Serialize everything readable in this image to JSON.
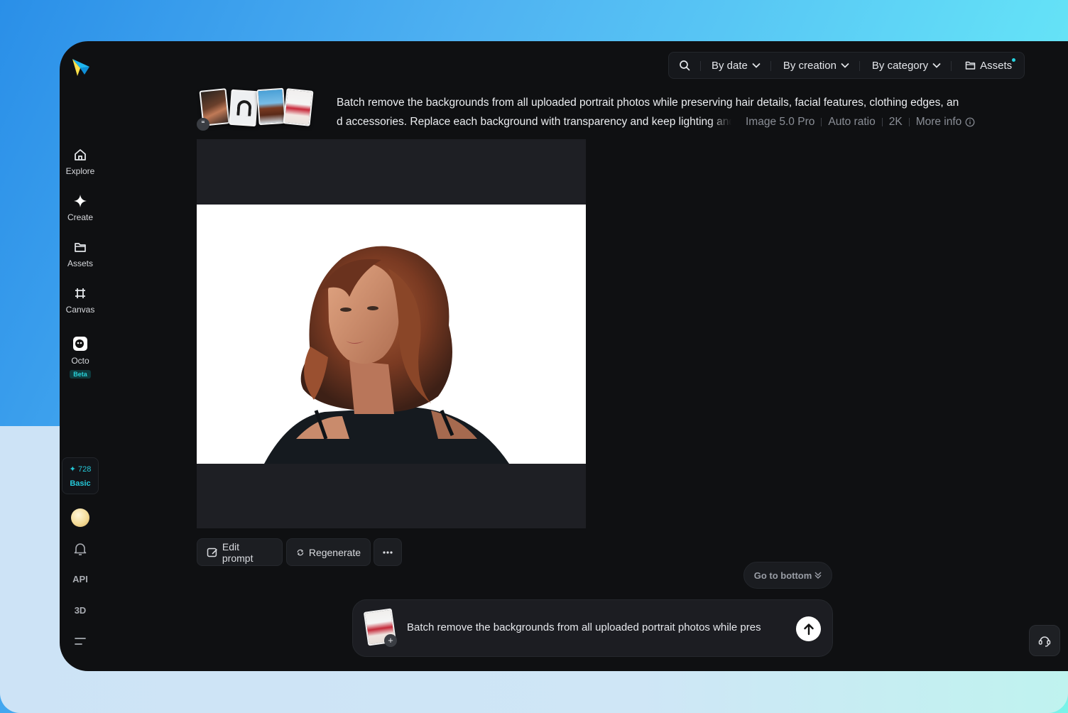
{
  "sidebar": {
    "items": [
      {
        "label": "Explore",
        "icon": "home-icon"
      },
      {
        "label": "Create",
        "icon": "sparkle-icon"
      },
      {
        "label": "Assets",
        "icon": "folder-icon"
      },
      {
        "label": "Canvas",
        "icon": "canvas-icon"
      },
      {
        "label": "Octo",
        "icon": "octo-icon",
        "badge": "Beta"
      }
    ],
    "credits": {
      "amount": "728",
      "plan": "Basic"
    },
    "api_label": "API",
    "threed_label": "3D"
  },
  "filterbar": {
    "by_date": "By date",
    "by_creation": "By creation",
    "by_category": "By category",
    "assets": "Assets"
  },
  "prompt": {
    "line1": "Batch remove the backgrounds from all uploaded portrait photos while preserving hair details, facial features, clothing edges, an",
    "line2": "d accessories. Replace each background with transparency and keep lighting and",
    "model": "Image 5.0 Pro",
    "ratio": "Auto ratio",
    "resolution": "2K",
    "more_info": "More info"
  },
  "actions": {
    "edit_prompt": "Edit prompt",
    "regenerate": "Regenerate"
  },
  "go_to_bottom": "Go to bottom",
  "chat": {
    "input_text": "Batch remove the backgrounds from all uploaded portrait photos while pres"
  },
  "colors": {
    "accent": "#25c8d8",
    "panel": "#0f1012"
  }
}
